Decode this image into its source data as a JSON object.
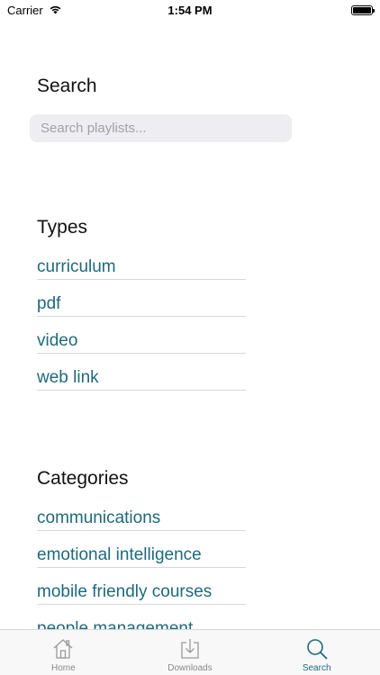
{
  "status_bar": {
    "carrier": "Carrier",
    "time": "1:54 PM"
  },
  "search": {
    "title": "Search",
    "placeholder": "Search playlists..."
  },
  "types": {
    "title": "Types",
    "items": [
      "curriculum",
      "pdf",
      "video",
      "web link"
    ]
  },
  "categories": {
    "title": "Categories",
    "items": [
      "communications",
      "emotional intelligence",
      "mobile friendly courses",
      "people management"
    ]
  },
  "tab_bar": {
    "tabs": [
      {
        "label": "Home",
        "icon": "house-icon",
        "active": false
      },
      {
        "label": "Downloads",
        "icon": "download-icon",
        "active": false
      },
      {
        "label": "Search",
        "icon": "magnifier-icon",
        "active": true
      }
    ]
  },
  "colors": {
    "accent": "#1e6a7a",
    "inactive_tab": "#8a8a8a"
  }
}
